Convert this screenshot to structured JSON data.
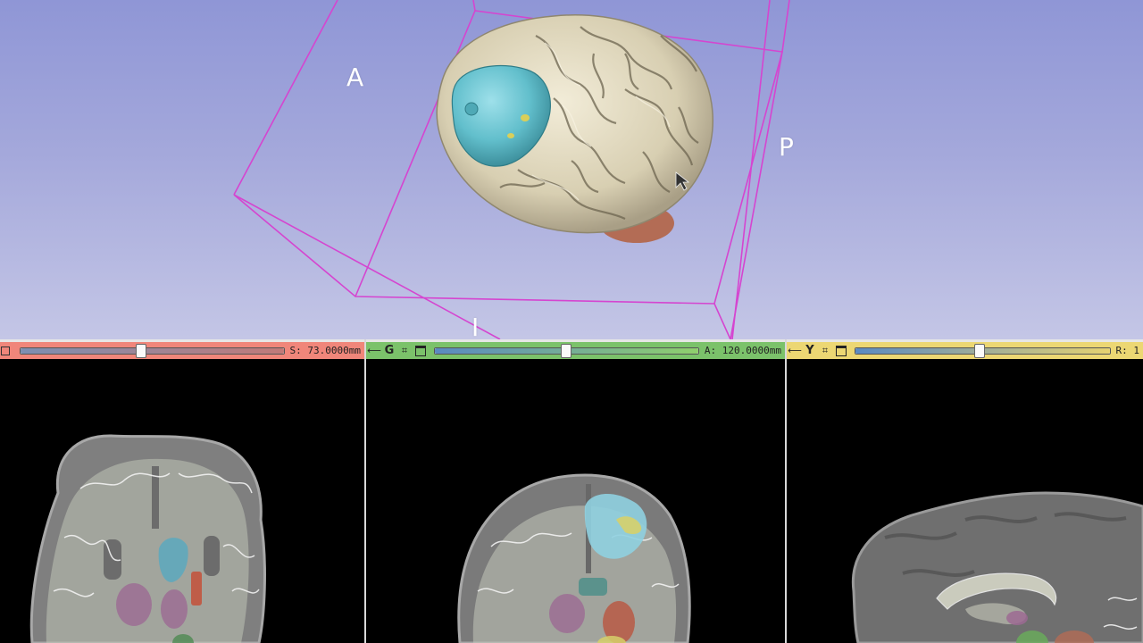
{
  "view3d": {
    "orientation_labels": {
      "anterior": "A",
      "posterior": "P",
      "inferior": "I"
    },
    "box_color": "#d545d0",
    "background_top": "#8f96d6",
    "background_bottom": "#c4c6e6",
    "segment_colors": {
      "cortex": "#e4dcc2",
      "tumor": "#67c3d0",
      "cerebellum": "#b36c55"
    }
  },
  "slice_views": {
    "red": {
      "name": "Red",
      "offset_label": "S: 73.0000mm",
      "slider_fraction": 0.46,
      "color": "#f0867a"
    },
    "green": {
      "name": "Green",
      "letter": "G",
      "offset_label": "A: 120.0000mm",
      "slider_fraction": 0.5,
      "color": "#7bc26a"
    },
    "yellow": {
      "name": "Yellow",
      "letter": "Y",
      "offset_label": "R: 1",
      "slider_fraction": 0.49,
      "color": "#ecd773"
    }
  },
  "icons": {
    "pin": "pin-icon",
    "link": "link-icon",
    "view_controls": "view-controls-icon",
    "maximize": "maximize-icon"
  }
}
